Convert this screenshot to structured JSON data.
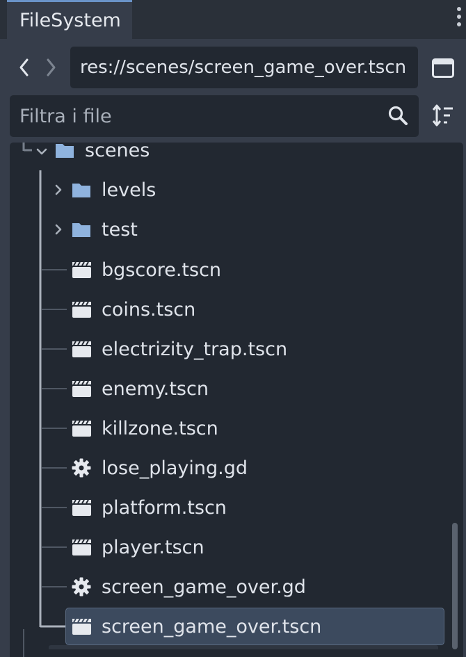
{
  "dock": {
    "tab_label": "FileSystem"
  },
  "navigation": {
    "back_icon": "chevron-left",
    "forward_icon": "chevron-right",
    "path": "res://scenes/screen_game_over.tscn"
  },
  "filter": {
    "placeholder": "Filtra i file"
  },
  "tree": {
    "root": {
      "label": "scenes",
      "icon": "folder-icon",
      "expanded": true
    },
    "items": [
      {
        "label": "levels",
        "type": "folder",
        "collapsed": true
      },
      {
        "label": "test",
        "type": "folder",
        "collapsed": true
      },
      {
        "label": "bgscore.tscn",
        "type": "scene"
      },
      {
        "label": "coins.tscn",
        "type": "scene"
      },
      {
        "label": "electrizity_trap.tscn",
        "type": "scene"
      },
      {
        "label": "enemy.tscn",
        "type": "scene"
      },
      {
        "label": "killzone.tscn",
        "type": "scene"
      },
      {
        "label": "lose_playing.gd",
        "type": "script"
      },
      {
        "label": "platform.tscn",
        "type": "scene"
      },
      {
        "label": "player.tscn",
        "type": "scene"
      },
      {
        "label": "screen_game_over.gd",
        "type": "script"
      },
      {
        "label": "screen_game_over.tscn",
        "type": "scene",
        "selected": true
      }
    ]
  },
  "colors": {
    "folder": "#8fb3de",
    "selection": "#3c4a5e",
    "tab_accent": "#6a93c8"
  }
}
